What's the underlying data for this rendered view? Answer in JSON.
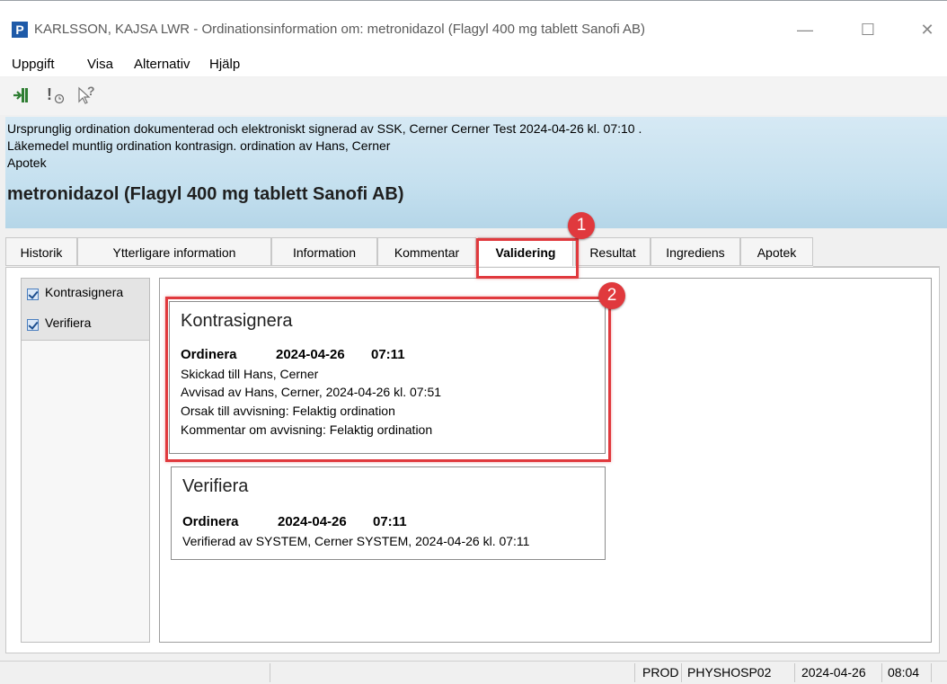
{
  "window": {
    "app_icon": "P",
    "title": "KARLSSON, KAJSA LWR - Ordinationsinformation om: metronidazol (Flagyl 400 mg tablett Sanofi AB)",
    "minimize": "—",
    "maximize": "☐",
    "close": "✕"
  },
  "menu": [
    "Uppgift",
    "Visa",
    "Alternativ",
    "Hjälp"
  ],
  "toolbar": {
    "icons": [
      "exit-icon",
      "alert-clock-icon",
      "help-cursor-icon"
    ],
    "alert_glyph": "!",
    "help_glyph": "?"
  },
  "banner": {
    "line1": "Ursprunglig ordination dokumenterad och elektroniskt signerad av SSK, Cerner Cerner Test 2024-04-26 kl. 07:10 .",
    "line2": "Läkemedel muntlig ordination kontrasign. ordination av Hans, Cerner",
    "line3": "Apotek",
    "drug": "metronidazol (Flagyl 400 mg tablett Sanofi AB)"
  },
  "tabs": [
    "Historik",
    "Ytterligare information",
    "Information",
    "Kommentar",
    "Validering",
    "Resultat",
    "Ingrediens",
    "Apotek"
  ],
  "active_tab": "Validering",
  "sidebar": {
    "items": [
      {
        "label": "Kontrasignera",
        "checked": true
      },
      {
        "label": "Verifiera",
        "checked": true
      }
    ]
  },
  "cards": {
    "kontrasignera": {
      "title": "Kontrasignera",
      "action": "Ordinera",
      "date": "2024-04-26",
      "time": "07:11",
      "lines": [
        "Skickad till Hans, Cerner",
        "Avvisad av Hans, Cerner, 2024-04-26 kl. 07:51",
        "Orsak till avvisning: Felaktig ordination",
        "Kommentar om avvisning: Felaktig ordination"
      ]
    },
    "verifiera": {
      "title": "Verifiera",
      "action": "Ordinera",
      "date": "2024-04-26",
      "time": "07:11",
      "lines": [
        "Verifierad av SYSTEM, Cerner SYSTEM, 2024-04-26 kl. 07:11"
      ]
    }
  },
  "annotations": {
    "badge1": "1",
    "badge2": "2",
    "highlight_color": "#e0393d"
  },
  "status": {
    "env": "PROD",
    "host": "PHYSHOSP02",
    "date": "2024-04-26",
    "time": "08:04"
  }
}
